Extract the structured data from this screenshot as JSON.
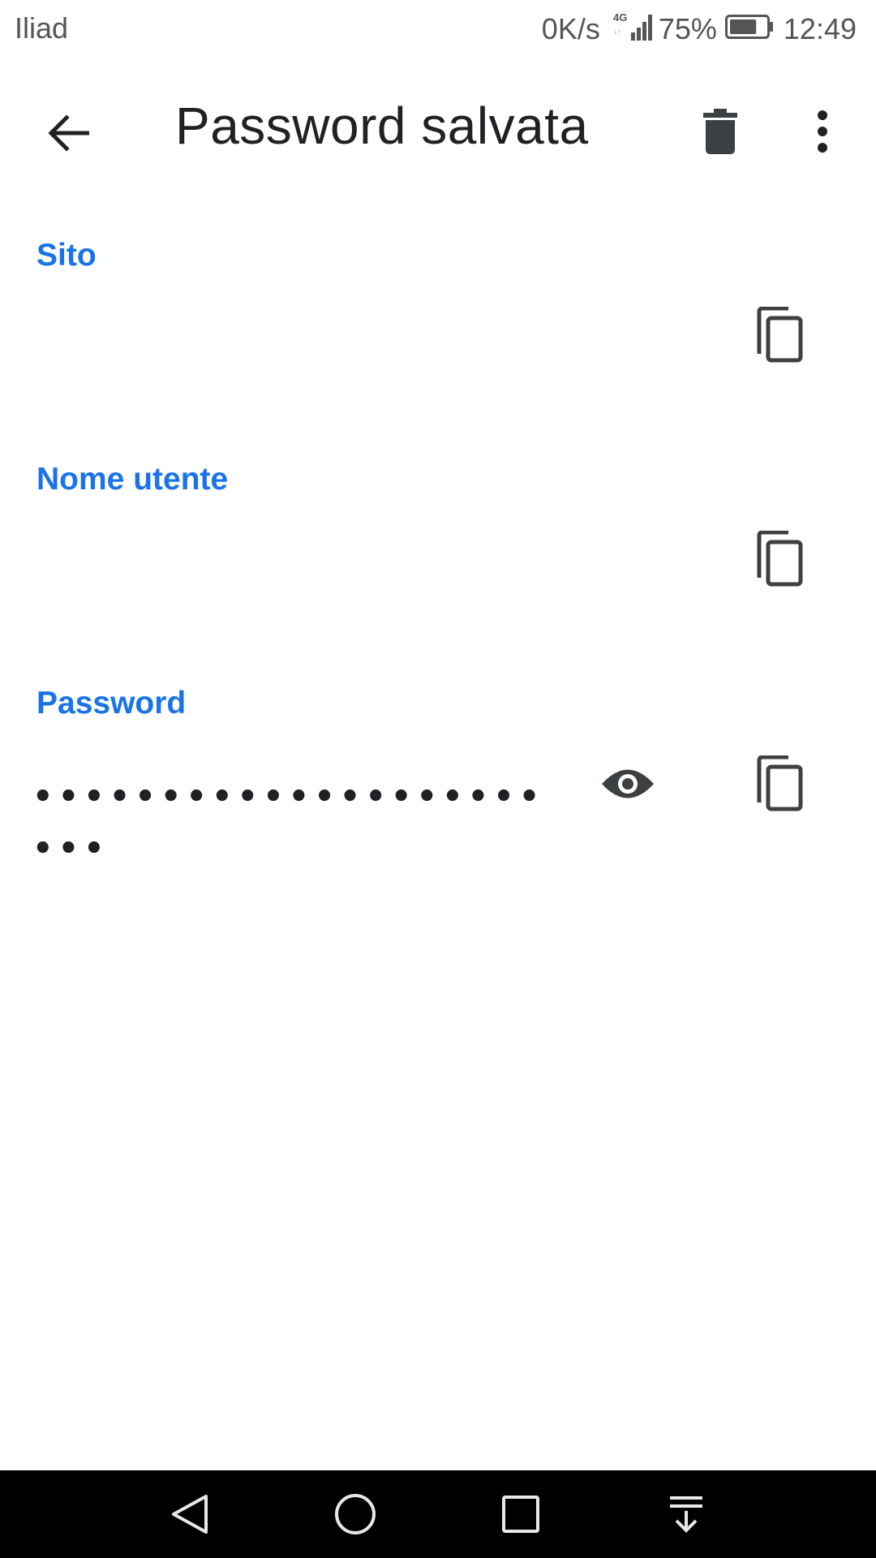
{
  "status_bar": {
    "carrier": "Iliad",
    "speed": "0K/s",
    "network": "4G",
    "battery_percent": "75%",
    "battery_level": 0.75,
    "time": "12:49"
  },
  "app_bar": {
    "title": "Password salvata",
    "back_icon": "arrow-back-icon",
    "delete_icon": "trash-icon",
    "more_icon": "more-vert-icon"
  },
  "fields": {
    "site": {
      "label": "Sito",
      "value": "",
      "copy_icon": "copy-icon"
    },
    "username": {
      "label": "Nome utente",
      "value": "",
      "copy_icon": "copy-icon"
    },
    "password": {
      "label": "Password",
      "masked_value": "•••••••••••••••••••••••",
      "visibility_icon": "eye-icon",
      "copy_icon": "copy-icon"
    }
  },
  "nav_bar": {
    "back_icon": "nav-back-triangle-icon",
    "home_icon": "nav-home-circle-icon",
    "recents_icon": "nav-recents-square-icon",
    "notifications_icon": "nav-pull-down-icon"
  },
  "colors": {
    "accent": "#1a73e8",
    "text_primary": "#202124",
    "icon": "#3c4043",
    "nav_background": "#000000"
  }
}
